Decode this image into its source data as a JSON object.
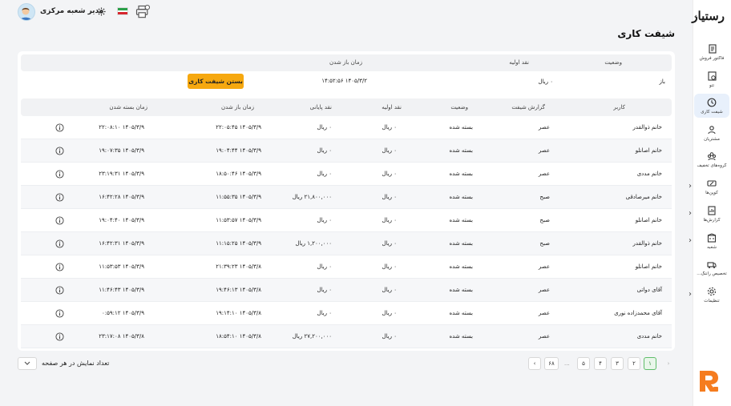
{
  "app": {
    "brand": "رستیار"
  },
  "topbar": {
    "user_name": "مدیر شعبه مرکزی"
  },
  "page": {
    "title": "شیفت کاری"
  },
  "sidebar": {
    "items": [
      {
        "label": "فاکتور فروش",
        "icon": "invoice-icon"
      },
      {
        "label": "تتو",
        "icon": "document-icon"
      },
      {
        "label": "شیفت کاری",
        "icon": "clock-icon",
        "active": true
      },
      {
        "label": "مشتریان",
        "icon": "user-icon"
      },
      {
        "label": "گروه‌های تخفیف",
        "icon": "group-icon"
      },
      {
        "label": "کوپن‌ها",
        "icon": "coupon-icon",
        "has_children": true
      },
      {
        "label": "گزارش‌ها",
        "icon": "report-icon",
        "has_children": true
      },
      {
        "label": "شعبه",
        "icon": "branch-icon",
        "has_children": true
      },
      {
        "label": "تخصیص راننگ...",
        "icon": "assign-icon"
      },
      {
        "label": "تنظیمات",
        "icon": "gear-icon",
        "has_children": true
      }
    ]
  },
  "current_shift": {
    "headers": {
      "status": "وضعیت",
      "initial_cash": "نقد اولیه",
      "opened_at": "زمان باز شدن"
    },
    "status": "باز",
    "initial_cash": "۰ ریال",
    "opened_at": "۱۴۰۵/۳/۲ ۱۴:۵۲:۵۶",
    "close_button": "بستن شیفت کاری"
  },
  "table": {
    "headers": {
      "user": "کاربر",
      "shift_report": "گزارش شیفت",
      "status": "وضعیت",
      "initial_cash": "نقد اولیه",
      "final_cash": "نقد پایانی",
      "opened_at": "زمان باز شدن",
      "closed_at": "زمان بسته شدن"
    },
    "rows": [
      {
        "user": "خانم ذوالقدر",
        "shift": "عصر",
        "status": "بسته شده",
        "initial": "۰ ریال",
        "final": "۰ ریال",
        "opened": "۱۴۰۵/۳/۹ ۲۲:۰۵:۴۵",
        "closed": "۱۴۰۵/۳/۹ ۲۲:۰۸:۱۰"
      },
      {
        "user": "خانم اصانلو",
        "shift": "عصر",
        "status": "بسته شده",
        "initial": "۰ ریال",
        "final": "۰ ریال",
        "opened": "۱۴۰۵/۳/۹ ۱۹:۰۴:۴۴",
        "closed": "۱۴۰۵/۳/۹ ۱۹:۰۷:۳۵"
      },
      {
        "user": "خانم مددی",
        "shift": "عصر",
        "status": "بسته شده",
        "initial": "۰ ریال",
        "final": "۰ ریال",
        "opened": "۱۴۰۵/۳/۹ ۱۸:۵۰:۴۶",
        "closed": "۱۴۰۵/۳/۹ ۲۳:۱۹:۳۱"
      },
      {
        "user": "خانم میرصادقی",
        "shift": "صبح",
        "status": "بسته شده",
        "initial": "۰ ریال",
        "final": "۲۱,۸۰۰,۰۰۰ ریال",
        "opened": "۱۴۰۵/۳/۹ ۱۱:۵۵:۳۵",
        "closed": "۱۴۰۵/۳/۹ ۱۶:۴۲:۲۸"
      },
      {
        "user": "خانم اصانلو",
        "shift": "صبح",
        "status": "بسته شده",
        "initial": "۰ ریال",
        "final": "۰ ریال",
        "opened": "۱۴۰۵/۳/۹ ۱۱:۵۳:۵۷",
        "closed": "۱۴۰۵/۳/۹ ۱۹:۰۴:۴۰"
      },
      {
        "user": "خانم ذوالقدر",
        "shift": "صبح",
        "status": "بسته شده",
        "initial": "۰ ریال",
        "final": "۱,۲۰۰,۰۰۰ ریال",
        "opened": "۱۴۰۵/۳/۹ ۱۱:۱۵:۲۵",
        "closed": "۱۴۰۵/۳/۹ ۱۶:۴۲:۳۱"
      },
      {
        "user": "خانم اصانلو",
        "shift": "عصر",
        "status": "بسته شده",
        "initial": "۰ ریال",
        "final": "۰ ریال",
        "opened": "۱۴۰۵/۳/۸ ۲۱:۳۹:۲۳",
        "closed": "۱۴۰۵/۳/۹ ۱۱:۵۳:۵۳"
      },
      {
        "user": "آقای دواتی",
        "shift": "عصر",
        "status": "بسته شده",
        "initial": "۰ ریال",
        "final": "۰ ریال",
        "opened": "۱۴۰۵/۳/۸ ۱۹:۴۶:۱۳",
        "closed": "۱۴۰۵/۳/۹ ۱۱:۴۶:۴۳"
      },
      {
        "user": "آقای محمدزاده نوری",
        "shift": "عصر",
        "status": "بسته شده",
        "initial": "۰ ریال",
        "final": "۰ ریال",
        "opened": "۱۴۰۵/۳/۸ ۱۹:۱۴:۱۰",
        "closed": "۱۴۰۵/۳/۹ ۰:۵۹:۱۲"
      },
      {
        "user": "خانم مددی",
        "shift": "عصر",
        "status": "بسته شده",
        "initial": "۰ ریال",
        "final": "۲۷,۲۰۰,۰۰۰ ریال",
        "opened": "۱۴۰۵/۳/۸ ۱۸:۵۴:۱۰",
        "closed": "۱۴۰۵/۳/۸ ۲۳:۱۷:۰۸"
      }
    ]
  },
  "pagination": {
    "pages": [
      "۱",
      "۲",
      "۳",
      "۴",
      "۵"
    ],
    "current": "۱",
    "ellipsis": "...",
    "last": "۶۸",
    "per_page_label": "تعداد نمایش در هر صفحه"
  },
  "colors": {
    "accent": "#f6a80f",
    "active_nav": "#e8f0fb",
    "active_page": "#5fbd6a",
    "logo": "#f57c1f"
  }
}
